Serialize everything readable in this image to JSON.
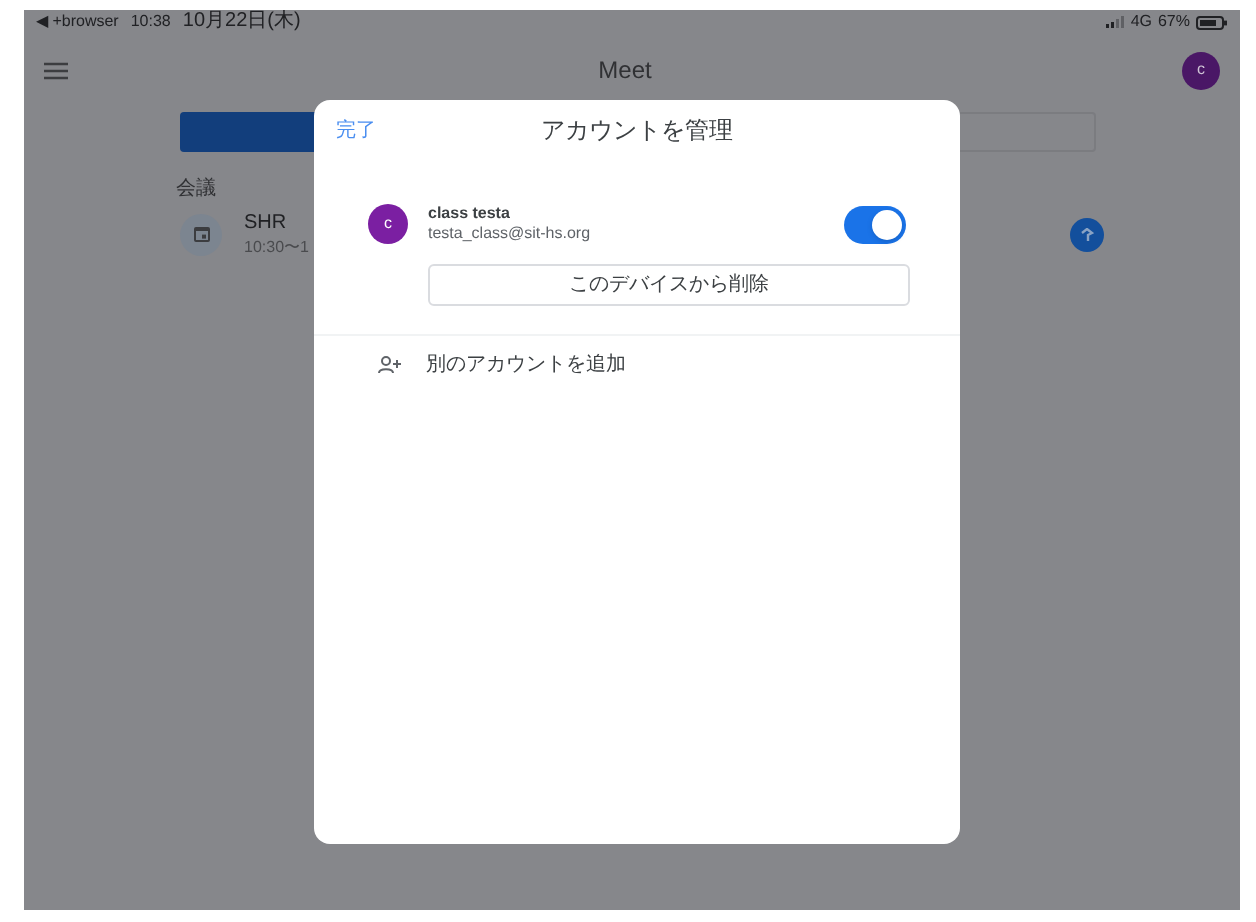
{
  "status_bar": {
    "back": "◀ +browser",
    "time": "10:38",
    "date": "10月22日(木)",
    "network": "4G",
    "battery": "67%"
  },
  "app_bar": {
    "title": "Meet",
    "avatar": "c"
  },
  "section": {
    "label": "会議"
  },
  "meeting": {
    "title": "SHR",
    "time": "10:30〜1"
  },
  "dialog": {
    "done": "完了",
    "title": "アカウントを管理",
    "account": {
      "avatar": "c",
      "name": "class testa",
      "email": "testa_class@sit-hs.org",
      "on": true
    },
    "remove_button": "このデバイスから削除",
    "add_account": "別のアカウントを追加"
  }
}
